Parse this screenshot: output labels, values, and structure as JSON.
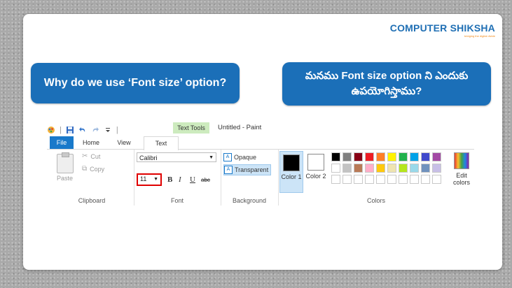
{
  "logo": {
    "name": "COMPUTER SHIKSHA",
    "tagline": "bridging the digital divide"
  },
  "question_en": "Why do we use ‘Font size’ option?",
  "question_te": "మనము Font size option ని ఎందుకు ఉపయోగిస్తాము?",
  "paint": {
    "context_tab": "Text Tools",
    "window_title": "Untitled - Paint",
    "tabs": [
      "File",
      "Home",
      "View",
      "Text"
    ],
    "clipboard": {
      "paste": "Paste",
      "cut": "Cut",
      "copy": "Copy",
      "label": "Clipboard"
    },
    "font": {
      "name": "Calibri",
      "size": "11",
      "bold": "B",
      "italic": "I",
      "underline": "U",
      "strike": "abc",
      "label": "Font"
    },
    "background": {
      "opaque": "Opaque",
      "transparent": "Transparent",
      "label": "Background"
    },
    "colors": {
      "color1": "Color 1",
      "color1_value": "#000000",
      "color2": "Color 2",
      "color2_value": "#ffffff",
      "edit": "Edit colors",
      "label": "Colors",
      "palette": [
        "#000000",
        "#7f7f7f",
        "#880015",
        "#ed1c24",
        "#ff7f27",
        "#fff200",
        "#22b14c",
        "#00a2e8",
        "#3f48cc",
        "#a349a4",
        "#ffffff",
        "#c3c3c3",
        "#b97a57",
        "#ffaec9",
        "#ffc90e",
        "#efe4b0",
        "#b5e61d",
        "#99d9ea",
        "#7092be",
        "#c8bfe7",
        "#ffffff",
        "#ffffff",
        "#ffffff",
        "#ffffff",
        "#ffffff",
        "#ffffff",
        "#ffffff",
        "#ffffff",
        "#ffffff",
        "#ffffff"
      ]
    }
  }
}
